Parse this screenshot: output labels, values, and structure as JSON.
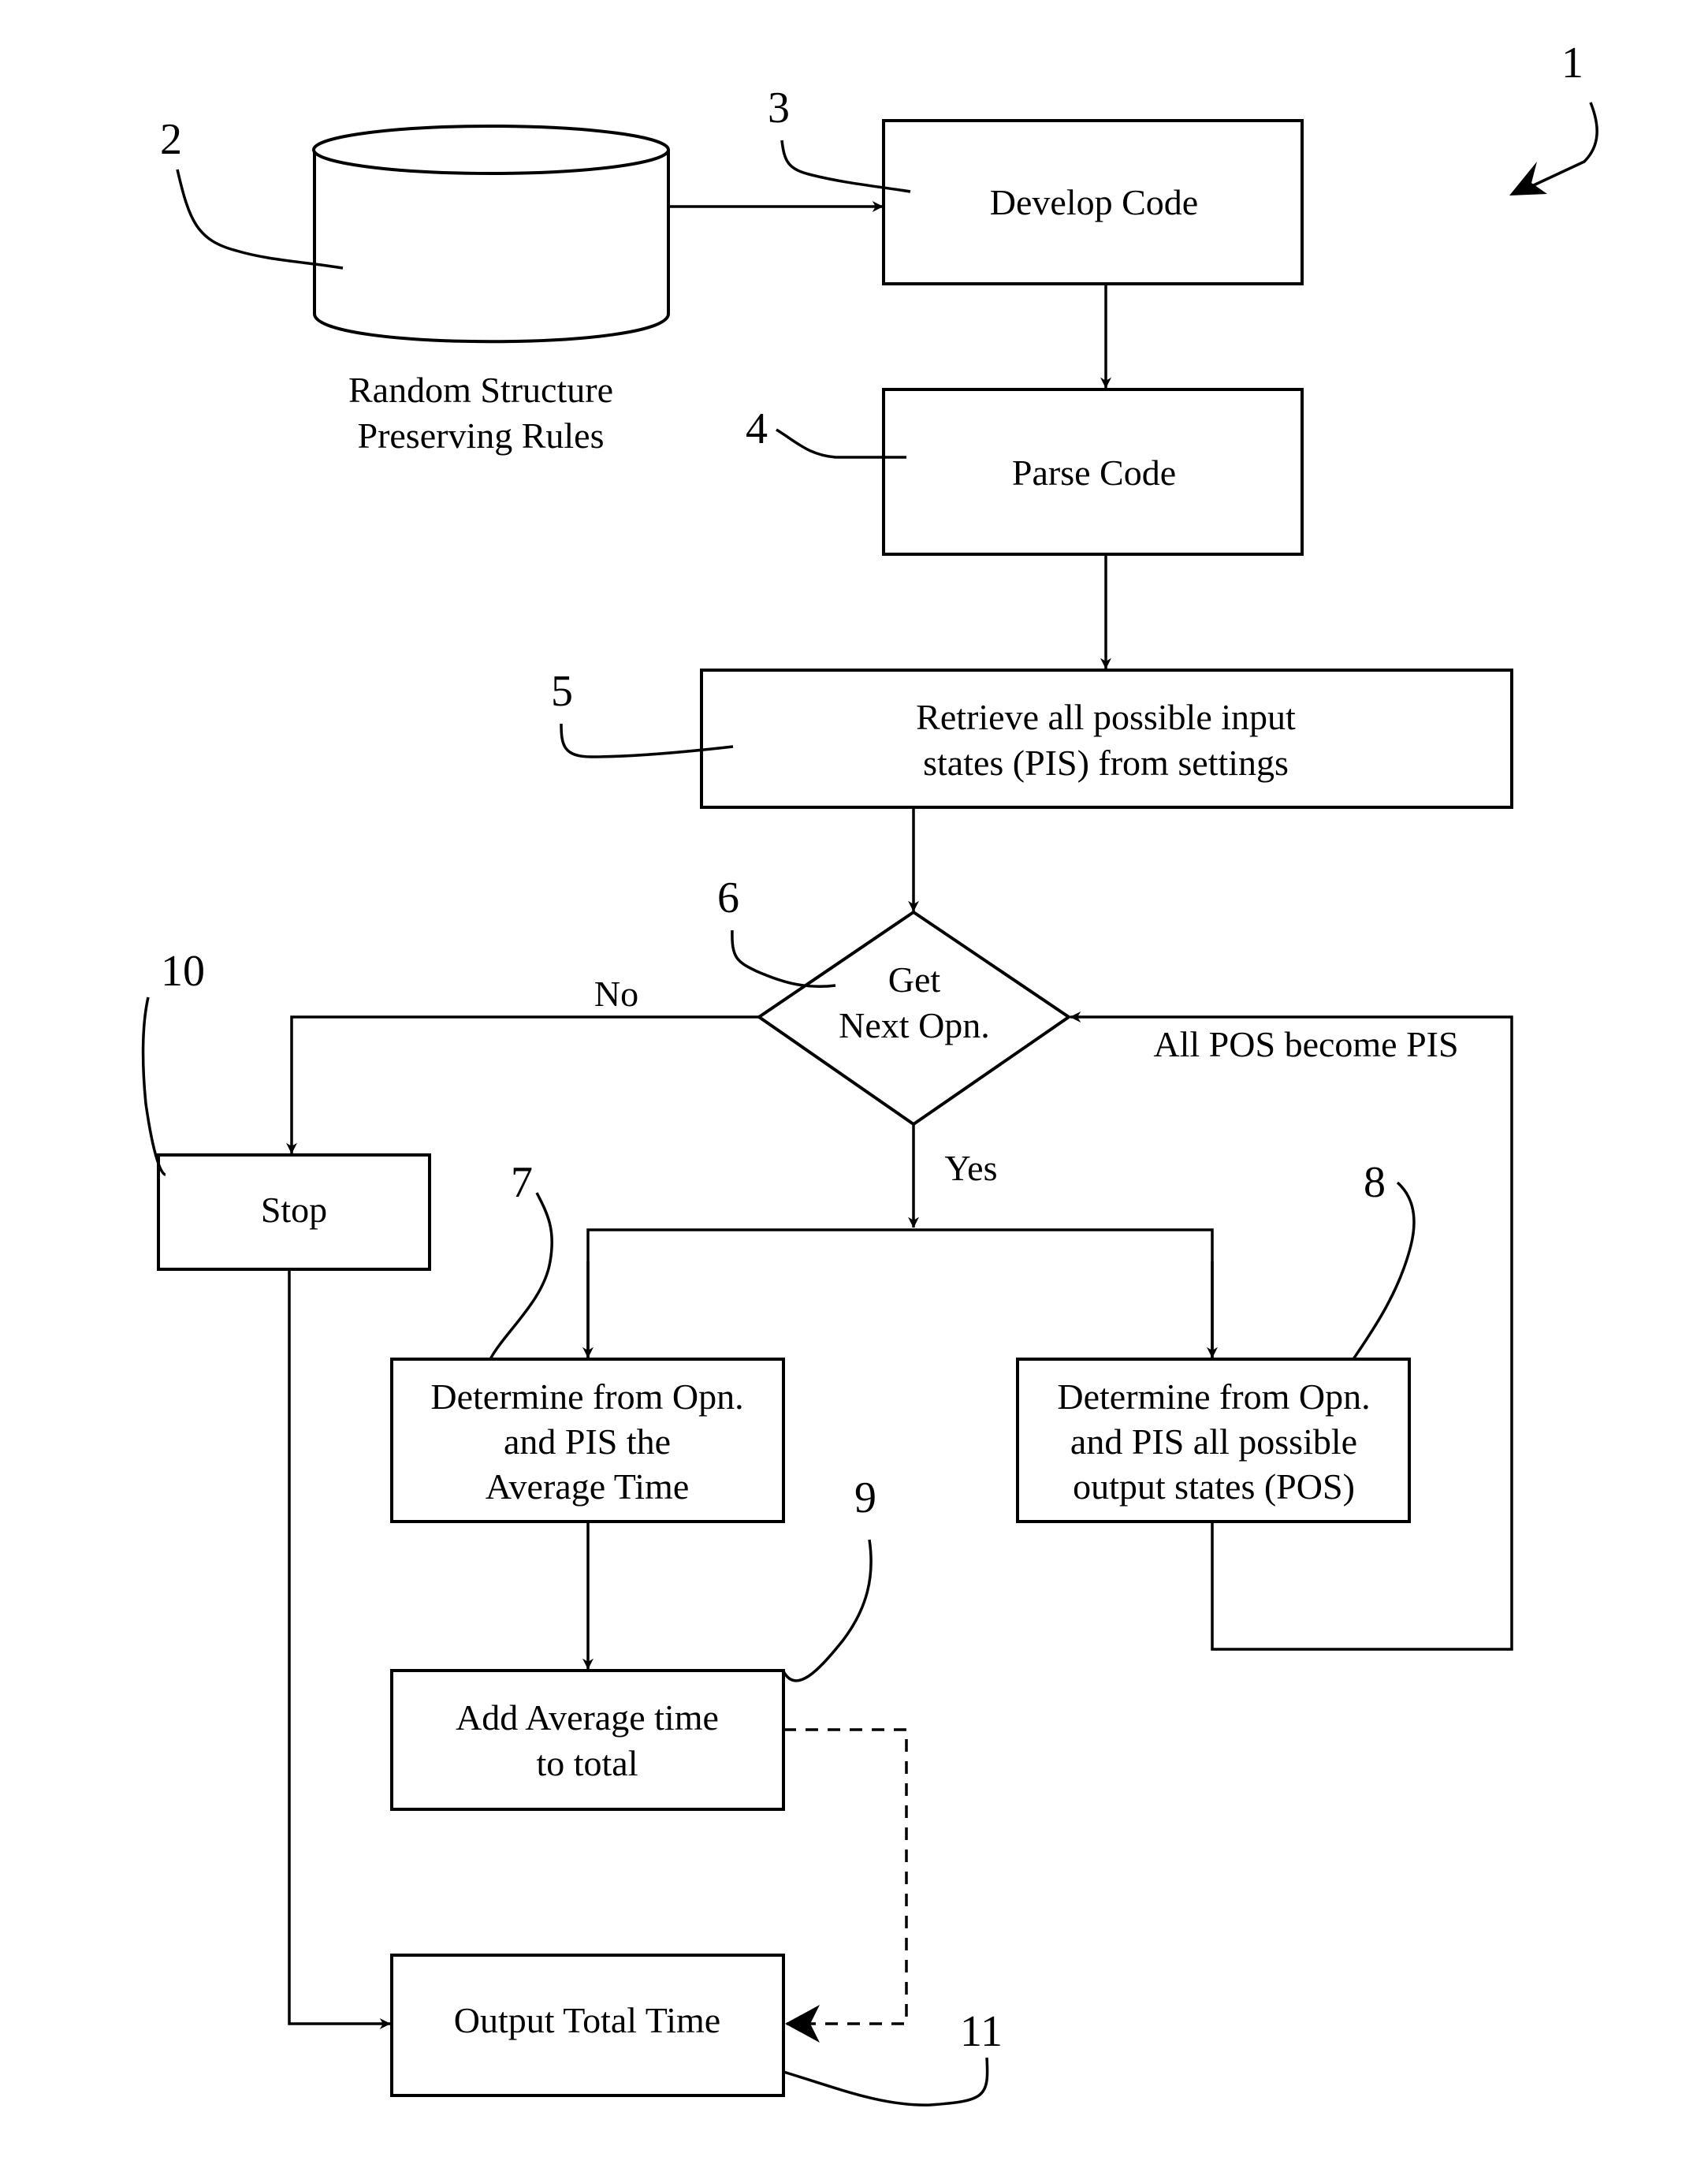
{
  "figure": {
    "reference_numeral": "1"
  },
  "nodes": {
    "database": {
      "ref": "2",
      "label_lines": [
        "Random Structure",
        "Preserving Rules"
      ]
    },
    "develop_code": {
      "ref": "3",
      "label_lines": [
        "Develop Code"
      ]
    },
    "parse_code": {
      "ref": "4",
      "label_lines": [
        "Parse Code"
      ]
    },
    "retrieve_pis": {
      "ref": "5",
      "label_lines": [
        "Retrieve all possible input",
        "states (PIS) from settings"
      ]
    },
    "get_next_opn": {
      "ref": "6",
      "label_lines": [
        "Get",
        "Next Opn."
      ]
    },
    "determine_average_time": {
      "ref": "7",
      "label_lines": [
        "Determine from Opn.",
        "and PIS the",
        "Average Time"
      ]
    },
    "determine_pos": {
      "ref": "8",
      "label_lines": [
        "Determine from Opn.",
        "and PIS all possible",
        "output states (POS)"
      ]
    },
    "add_average_time": {
      "ref": "9",
      "label_lines": [
        "Add Average time",
        "to total"
      ]
    },
    "stop": {
      "ref": "10",
      "label_lines": [
        "Stop"
      ]
    },
    "output_total_time": {
      "ref": "11",
      "label_lines": [
        "Output Total Time"
      ]
    }
  },
  "edges": {
    "no_label": "No",
    "yes_label": "Yes",
    "loop_label": "All POS become PIS"
  }
}
